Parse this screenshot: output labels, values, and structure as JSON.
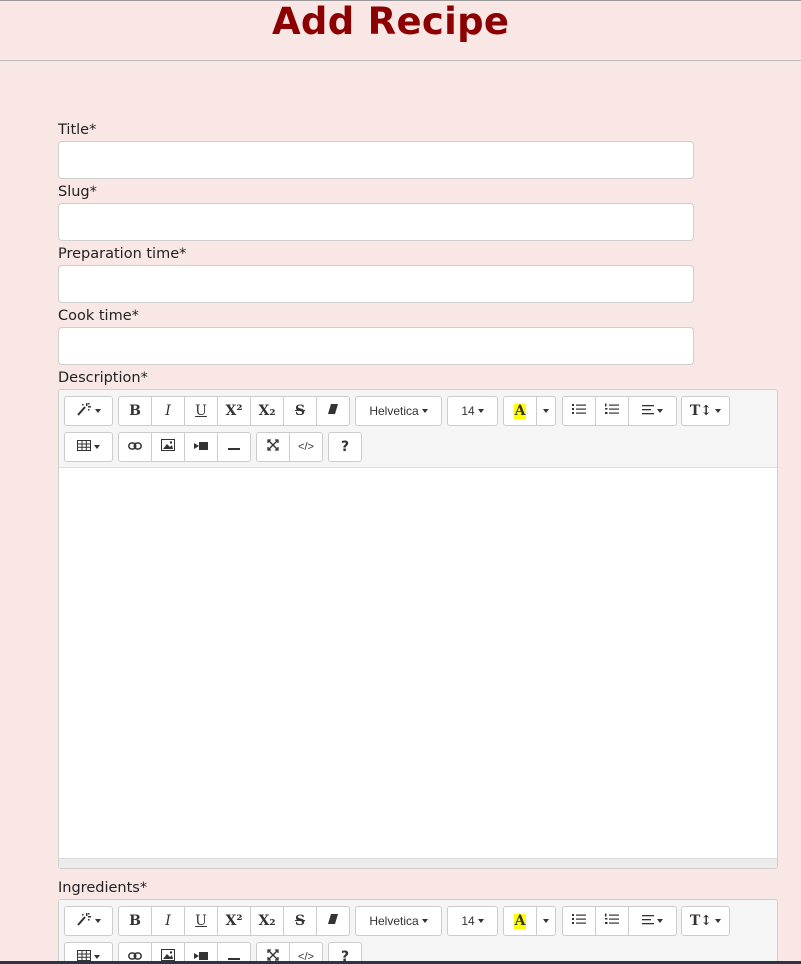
{
  "header": {
    "title": "Add Recipe"
  },
  "form": {
    "title_label": "Title*",
    "slug_label": "Slug*",
    "prep_label": "Preparation time*",
    "cook_label": "Cook time*",
    "description_label": "Description*",
    "ingredients_label": "Ingredients*"
  },
  "toolbar": {
    "font_name": "Helvetica",
    "font_size": "14",
    "color_letter": "A",
    "help": "?",
    "code": "</>",
    "bold": "B",
    "italic": "I",
    "underline": "U",
    "superscript": "X²",
    "subscript": "X₂",
    "strike": "S"
  },
  "colors": {
    "title": "#8b0000",
    "background": "#f8e7e5",
    "highlight": "#ffff00"
  }
}
